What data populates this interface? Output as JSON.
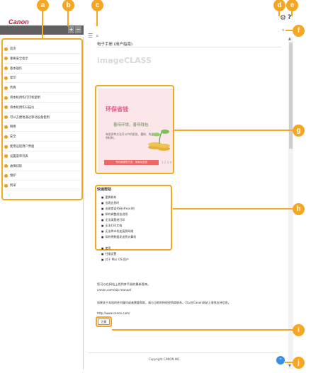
{
  "header": {
    "logo": "Canon",
    "gear_icon": "gear-icon",
    "help_icon": "help-icon"
  },
  "toolbar": {
    "tree_expand": "+",
    "tree_collapse": "−",
    "list_icon": "☰",
    "search_icon": "⌕",
    "next_icon": "›"
  },
  "sidebar": {
    "items": [
      {
        "label": "首页"
      },
      {
        "label": "重要安全指示"
      },
      {
        "label": "基本操作"
      },
      {
        "label": "复印"
      },
      {
        "label": "传真"
      },
      {
        "label": "将本机用作打印机使用"
      },
      {
        "label": "将本机用作扫描仪"
      },
      {
        "label": "可以方便地通过移动设备使用"
      },
      {
        "label": "网络"
      },
      {
        "label": "安全"
      },
      {
        "label": "使用远程用户界面"
      },
      {
        "label": "设置菜单列表"
      },
      {
        "label": "故障排除"
      },
      {
        "label": "维护"
      },
      {
        "label": "附录"
      }
    ]
  },
  "main": {
    "title": "电子手册 (用户指南)",
    "brand": "imageCLASS",
    "banner": {
      "title": "环保省钱",
      "subtitle": "善待环境，善待钱包",
      "desc": "有很多种方法可以节约纸张、墨粉、电量和耗材。",
      "link": "节约资源的方法，请参见此处",
      "dots": "1  2  3  4"
    },
    "quick": {
      "title": "快速帮助",
      "items": [
        "更换耗材",
        "出现信息时",
        "出现错误代码(#xxx)时",
        "如何调整纸张进纸",
        "无法清楚地打印",
        "无法打印文档",
        "无法将本机连接到网络",
        "如何将数据发送到计算机",
        "使用",
        "扫描设置",
        "对于 Mac OS 用户"
      ]
    },
    "info": {
      "line1": "您可以在网站上找到本手册的最新版本。",
      "line1b": "canon.com/oip-manual",
      "line2": "如果关于本机的任何疑问或者需要帮助，请与当地的授权经销商联系。可以在Canon网站上查找支持信息。",
      "line2b": "http://www.canon.com/"
    },
    "notice_btn": "注意",
    "copyright": "Copyright CANON INC."
  },
  "callouts": [
    "a",
    "b",
    "c",
    "d",
    "e",
    "f",
    "g",
    "h",
    "i",
    "j"
  ],
  "colors": {
    "accent": "#f5a623",
    "banner_bg": "#fbe6ea",
    "top_button": "#3a8ee6",
    "logo": "#c8102e"
  }
}
